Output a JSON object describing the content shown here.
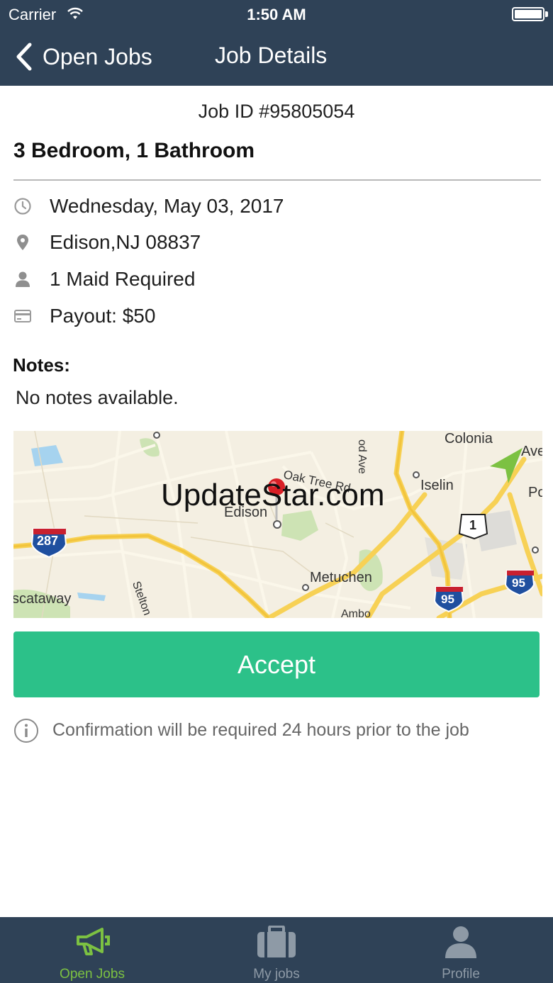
{
  "status_bar": {
    "carrier": "Carrier",
    "time": "1:50 AM"
  },
  "nav": {
    "back_label": "Open Jobs",
    "title": "Job Details"
  },
  "job": {
    "id_text": "Job ID #95805054",
    "headline": "3 Bedroom, 1 Bathroom",
    "details": [
      {
        "icon": "clock-icon",
        "text": "Wednesday, May 03, 2017"
      },
      {
        "icon": "location-pin-icon",
        "text": "Edison,NJ 08837"
      },
      {
        "icon": "person-icon",
        "text": "1 Maid Required"
      },
      {
        "icon": "credit-card-icon",
        "text": "Payout: $50"
      }
    ],
    "notes_heading": "Notes:",
    "notes_text": "No notes available."
  },
  "map": {
    "labels": {
      "colonia": "Colonia",
      "ave_right": "Ave",
      "od_ave": "od Ave",
      "oak_tree": "Oak Tree Rd",
      "iselin": "Iselin",
      "po": "Po",
      "edison": "Edison",
      "metuchen": "Metuchen",
      "stelton": "Stelton",
      "cataway": "scataway",
      "amb": "Ambo"
    },
    "shields": {
      "i287": "287",
      "us1": "1",
      "i95_left": "95",
      "i95_right": "95"
    },
    "watermark": "UpdateStar.com"
  },
  "accept_label": "Accept",
  "info_text": "Confirmation will be required 24 hours prior to the job",
  "tabs": [
    {
      "label": "Open Jobs",
      "icon": "megaphone-icon",
      "active": true
    },
    {
      "label": "My jobs",
      "icon": "briefcase-icon",
      "active": false
    },
    {
      "label": "Profile",
      "icon": "person-icon",
      "active": false
    }
  ],
  "colors": {
    "nav_bg": "#2f4257",
    "accept_bg": "#2cc189",
    "tab_active": "#7cc142",
    "tab_inactive": "#8e9aa6"
  }
}
